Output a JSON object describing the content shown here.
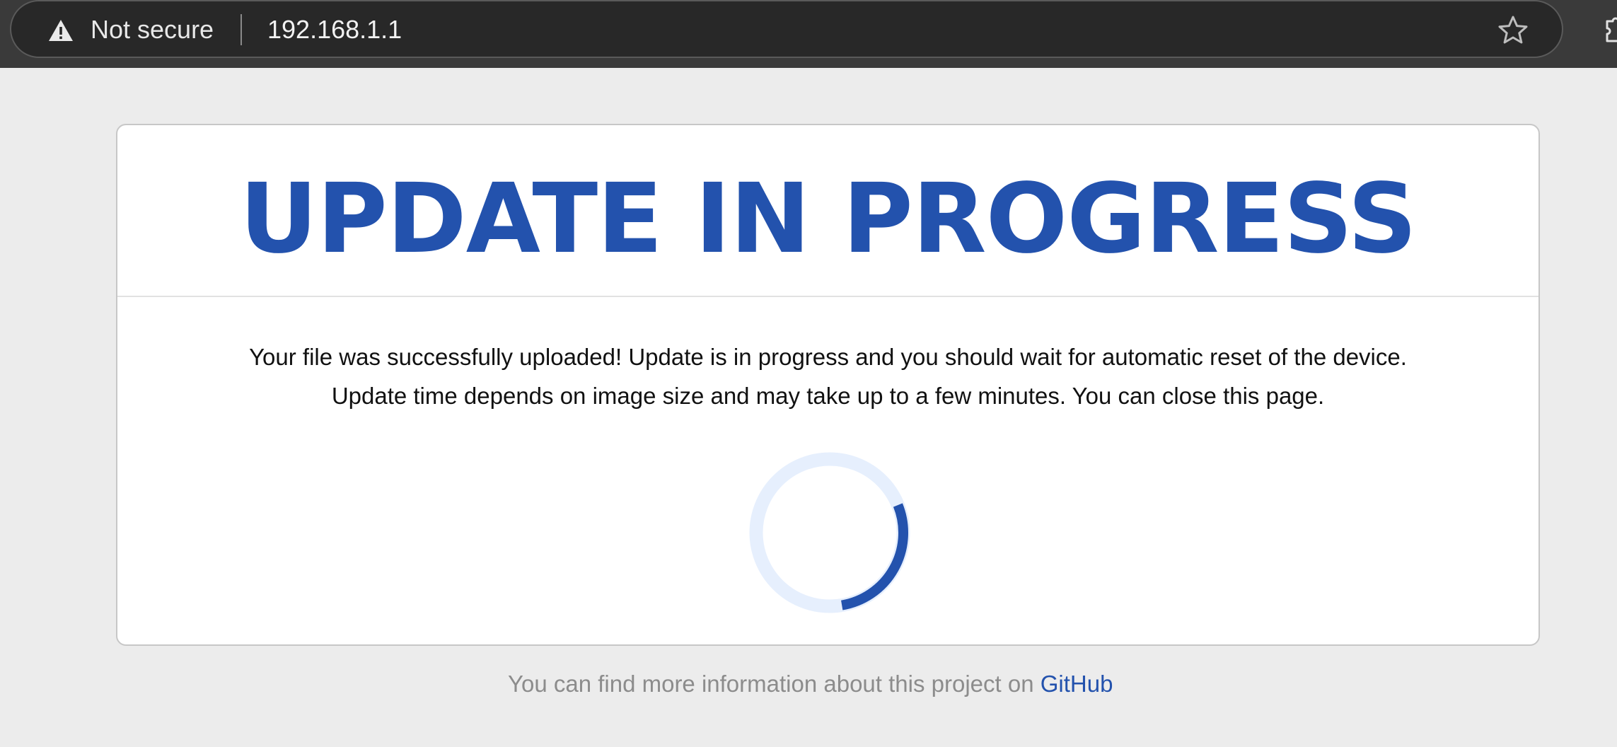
{
  "browser": {
    "security_label": "Not secure",
    "url": "192.168.1.1",
    "icons": {
      "security": "warning-triangle-icon",
      "bookmark": "star-outline-icon",
      "extension": "puzzle-icon"
    }
  },
  "card": {
    "title": "UPDATE IN PROGRESS",
    "message_line1": "Your file was successfully uploaded! Update is in progress and you should wait for automatic reset of the device.",
    "message_line2": "Update time depends on image size and may take up to a few minutes. You can close this page.",
    "spinner": {
      "icon": "loading-spinner-icon",
      "track_color": "#e6effd",
      "accent_color": "#2352ad"
    }
  },
  "footer": {
    "text": "You can find more information about this project on",
    "link_label": "GitHub"
  },
  "colors": {
    "accent": "#2352ad",
    "page_background": "#ececec",
    "card_background": "#ffffff",
    "muted_text": "#8c8c8c"
  }
}
